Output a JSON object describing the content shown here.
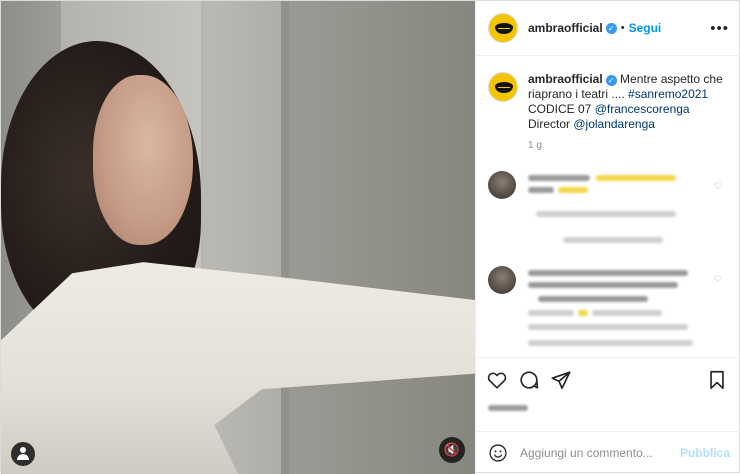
{
  "post": {
    "username": "ambraofficial",
    "follow_label": "Segui",
    "separator": "•",
    "more_label": "•••",
    "verified_mark": "✓",
    "caption_plain": "Mentre aspetto che riaprano i teatri .... ",
    "hashtag": "#sanremo2021",
    "caption_mid": " CODICE 07 ",
    "mention_1": "@francescorenga",
    "caption_tail": " Director ",
    "mention_2": "@jolandarenga",
    "time_ago": "1 g"
  },
  "media": {
    "mute_icon": "speaker-muted-icon",
    "mute_glyph": "🔇",
    "tag_icon": "user-tag-icon"
  },
  "actions": {
    "like_icon": "heart-icon",
    "comment_icon": "comment-bubble-icon",
    "share_icon": "paper-plane-icon",
    "save_icon": "bookmark-icon"
  },
  "comment_box": {
    "placeholder": "Aggiungi un commento...",
    "publish_label": "Pubblica",
    "emoji_icon": "smiley-icon"
  },
  "colors": {
    "link_blue": "#0095f6",
    "verified_blue": "#3897f0",
    "avatar_yellow": "#f5c400",
    "publish_disabled": "#b2dffc"
  }
}
